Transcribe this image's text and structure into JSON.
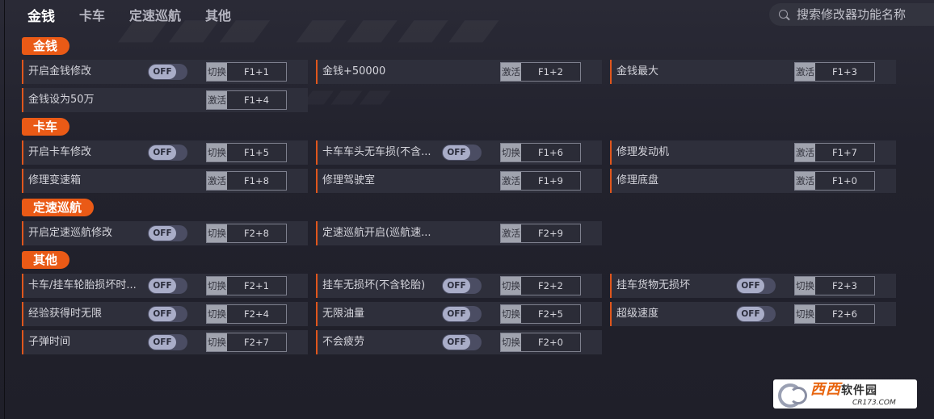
{
  "nav": {
    "tabs": [
      "金钱",
      "卡车",
      "定速巡航",
      "其他"
    ],
    "active": 0
  },
  "search": {
    "placeholder": "搜索修改器功能名称"
  },
  "watermark": {
    "brand": "西西",
    "suffix": "软件园",
    "url": "CR173.COM"
  },
  "colors": {
    "accent": "#ea5a16",
    "panel": "#2e2f3b",
    "background": "#22222d"
  },
  "sections": [
    {
      "title": "金钱"
    },
    {
      "title": "卡车"
    },
    {
      "title": "定速巡航"
    },
    {
      "title": "其他"
    }
  ],
  "rows": [
    {
      "label": "开启金钱修改",
      "toggle": "OFF",
      "action": "切换",
      "key": "F1+1"
    },
    {
      "label": "金钱+50000",
      "action": "激活",
      "key": "F1+2"
    },
    {
      "label": "金钱最大",
      "action": "激活",
      "key": "F1+3"
    },
    {
      "label": "金钱设为50万",
      "action": "激活",
      "key": "F1+4"
    },
    {
      "label": "开启卡车修改",
      "toggle": "OFF",
      "action": "切换",
      "key": "F1+5"
    },
    {
      "label": "卡车车头无车损(不含...",
      "toggle": "OFF",
      "action": "切换",
      "key": "F1+6"
    },
    {
      "label": "修理发动机",
      "action": "激活",
      "key": "F1+7"
    },
    {
      "label": "修理变速箱",
      "action": "激活",
      "key": "F1+8"
    },
    {
      "label": "修理驾驶室",
      "action": "激活",
      "key": "F1+9"
    },
    {
      "label": "修理底盘",
      "action": "激活",
      "key": "F1+0"
    },
    {
      "label": "开启定速巡航修改",
      "toggle": "OFF",
      "action": "切换",
      "key": "F2+8"
    },
    {
      "label": "定速巡航开启(巡航速...",
      "action": "激活",
      "key": "F2+9"
    },
    {
      "label": "卡车/挂车轮胎损坏时...",
      "toggle": "OFF",
      "action": "切换",
      "key": "F2+1"
    },
    {
      "label": "挂车无损坏(不含轮胎)",
      "toggle": "OFF",
      "action": "切换",
      "key": "F2+2"
    },
    {
      "label": "挂车货物无损坏",
      "toggle": "OFF",
      "action": "切换",
      "key": "F2+3"
    },
    {
      "label": "经验获得时无限",
      "toggle": "OFF",
      "action": "切换",
      "key": "F2+4"
    },
    {
      "label": "无限油量",
      "toggle": "OFF",
      "action": "切换",
      "key": "F2+5"
    },
    {
      "label": "超级速度",
      "toggle": "OFF",
      "action": "切换",
      "key": "F2+6"
    },
    {
      "label": "子弹时间",
      "toggle": "OFF",
      "action": "切换",
      "key": "F2+7"
    },
    {
      "label": "不会疲劳",
      "toggle": "OFF",
      "action": "切换",
      "key": "F2+0"
    }
  ]
}
